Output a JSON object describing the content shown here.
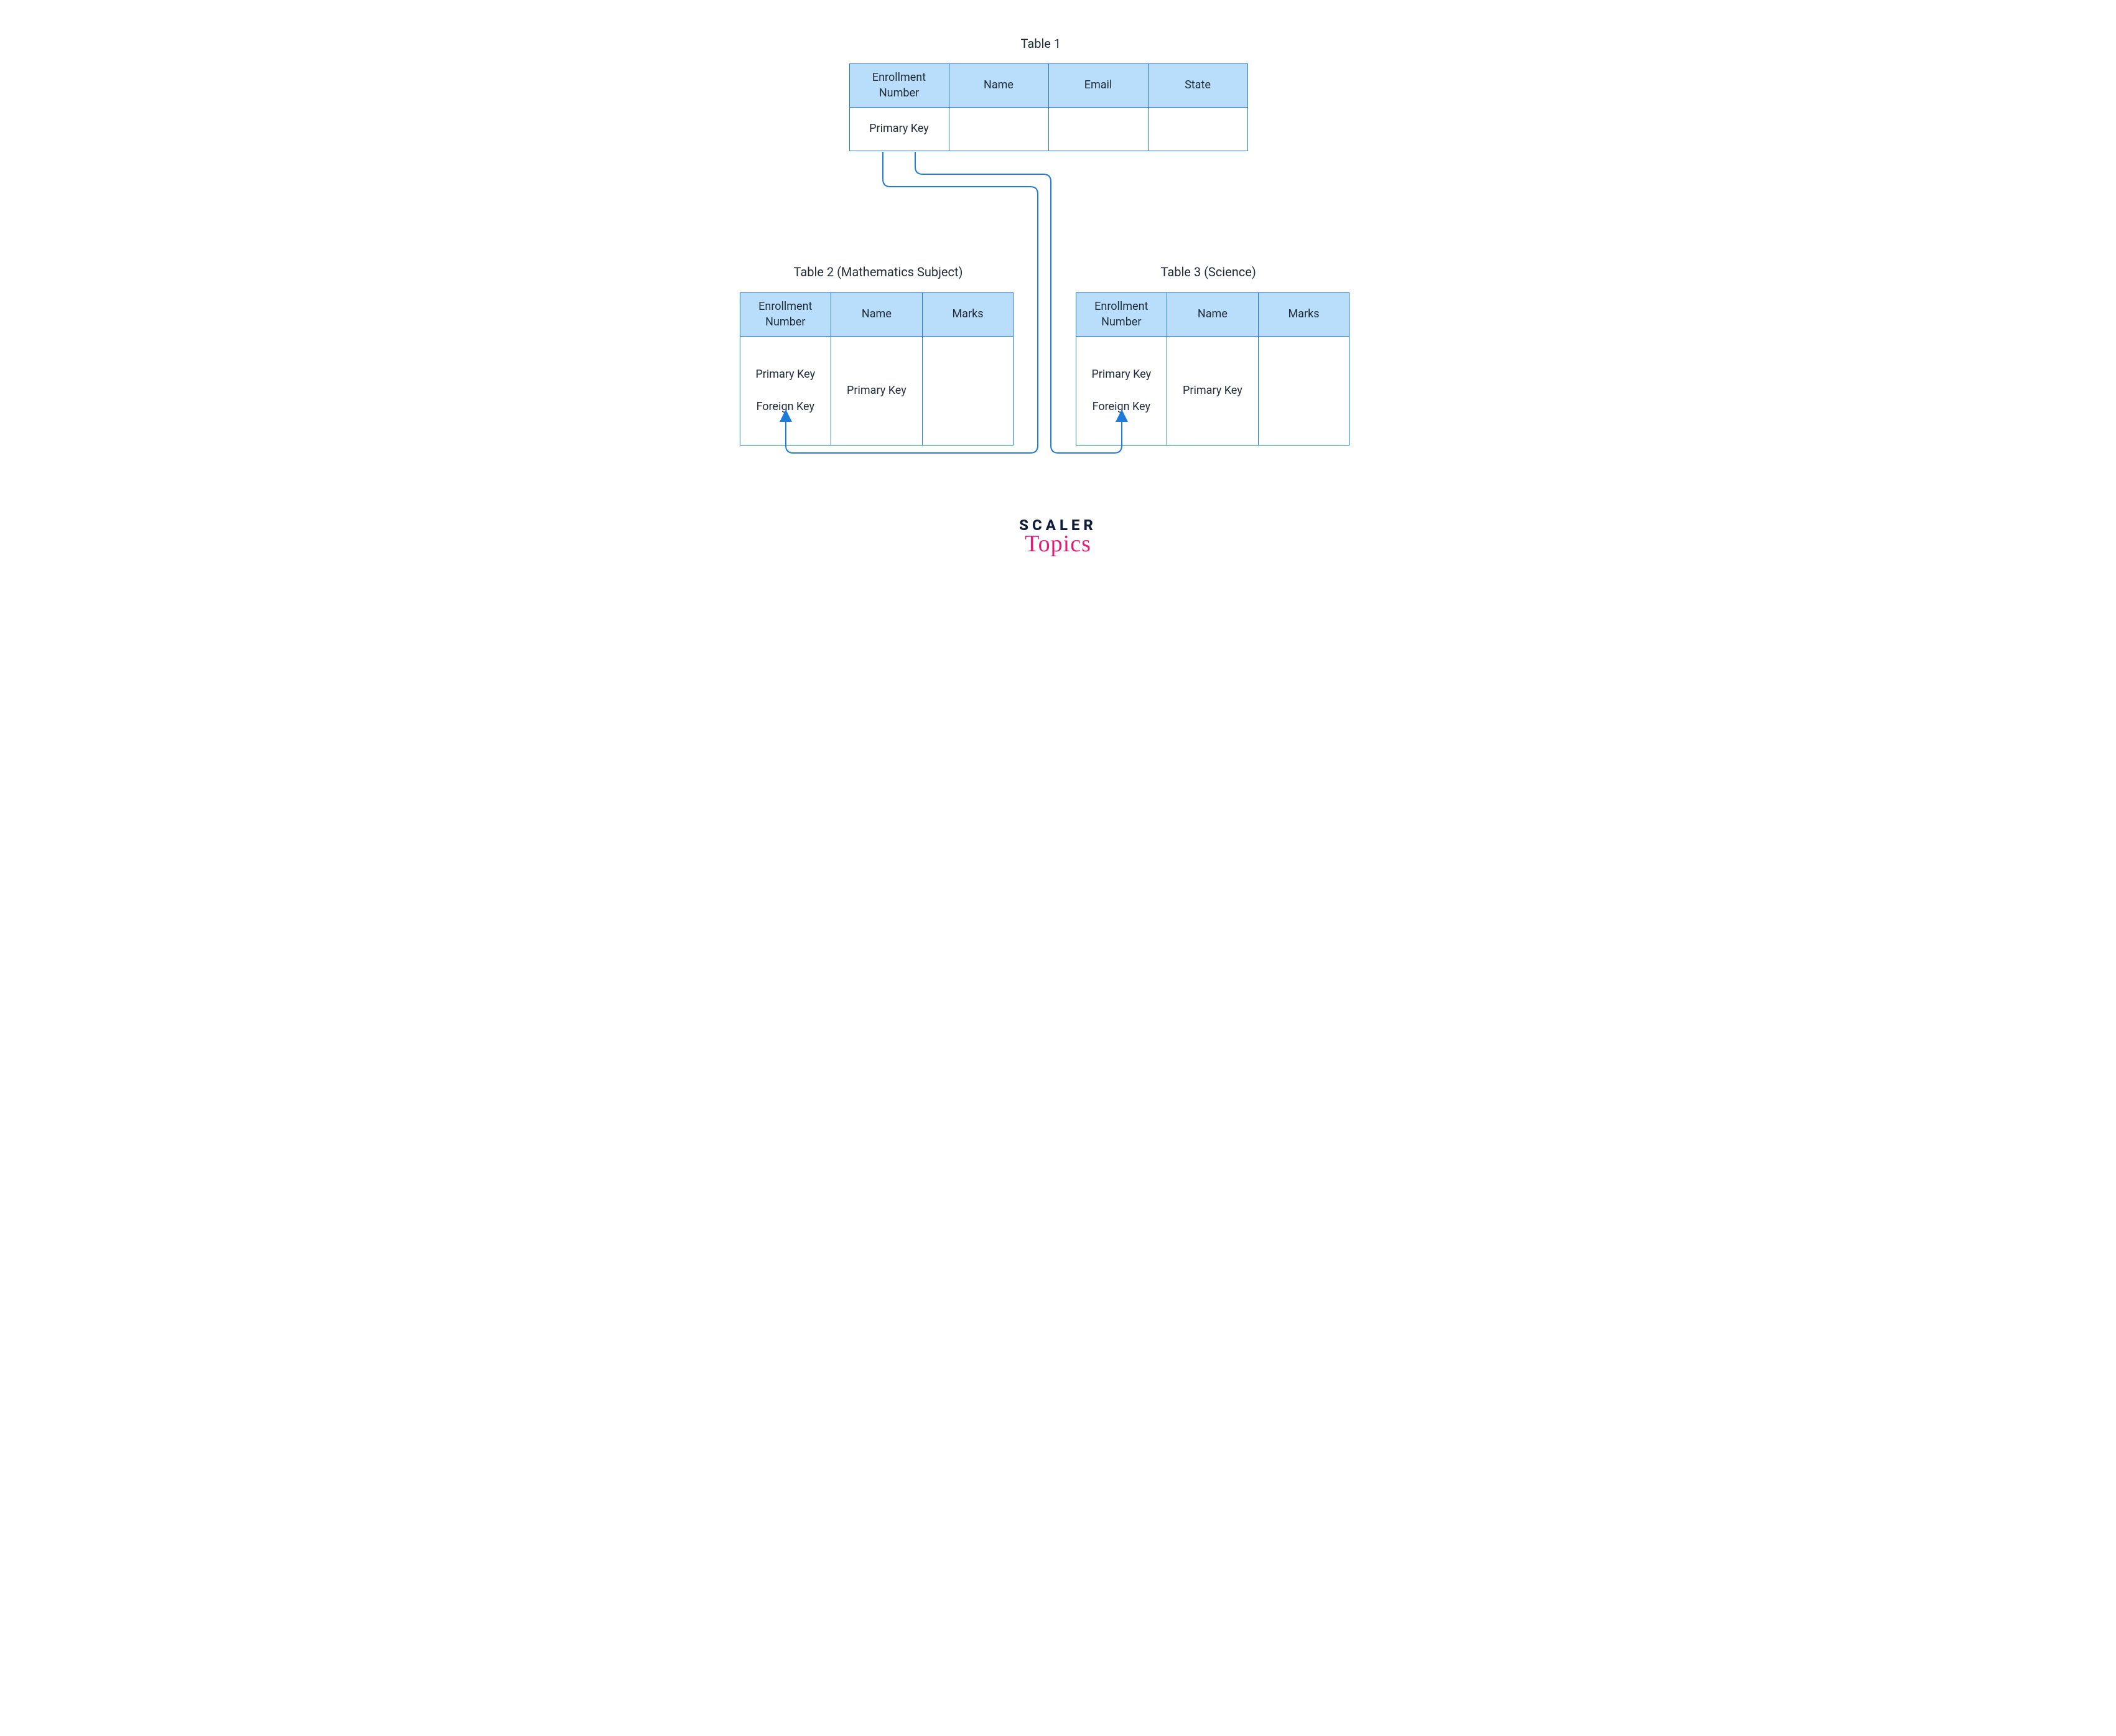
{
  "colors": {
    "border": "#1f7bd8",
    "header_fill": "#b8defb",
    "text": "#1f2a37",
    "logo_dark": "#111b3b",
    "logo_pink": "#e31c79"
  },
  "tables": {
    "t1": {
      "title": "Table 1",
      "headers": [
        "Enrollment Number",
        "Name",
        "Email",
        "State"
      ],
      "row": [
        "Primary Key",
        "",
        "",
        ""
      ]
    },
    "t2": {
      "title": "Table 2 (Mathematics Subject)",
      "headers": [
        "Enrollment Number",
        "Name",
        "Marks"
      ],
      "row": {
        "col1_line1": "Primary Key",
        "col1_line2": "Foreign Key",
        "col2": "Primary Key",
        "col3": ""
      }
    },
    "t3": {
      "title": "Table 3 (Science)",
      "headers": [
        "Enrollment Number",
        "Name",
        "Marks"
      ],
      "row": {
        "col1_line1": "Primary Key",
        "col1_line2": "Foreign Key",
        "col2": "Primary Key",
        "col3": ""
      }
    }
  },
  "connectors": {
    "description": "Two rounded connectors from Table 1 Enrollment Number primary key down to Table 2 and Table 3 Enrollment Number foreign keys with arrowheads."
  },
  "logo": {
    "line1": "SCALER",
    "line2": "Topics"
  }
}
